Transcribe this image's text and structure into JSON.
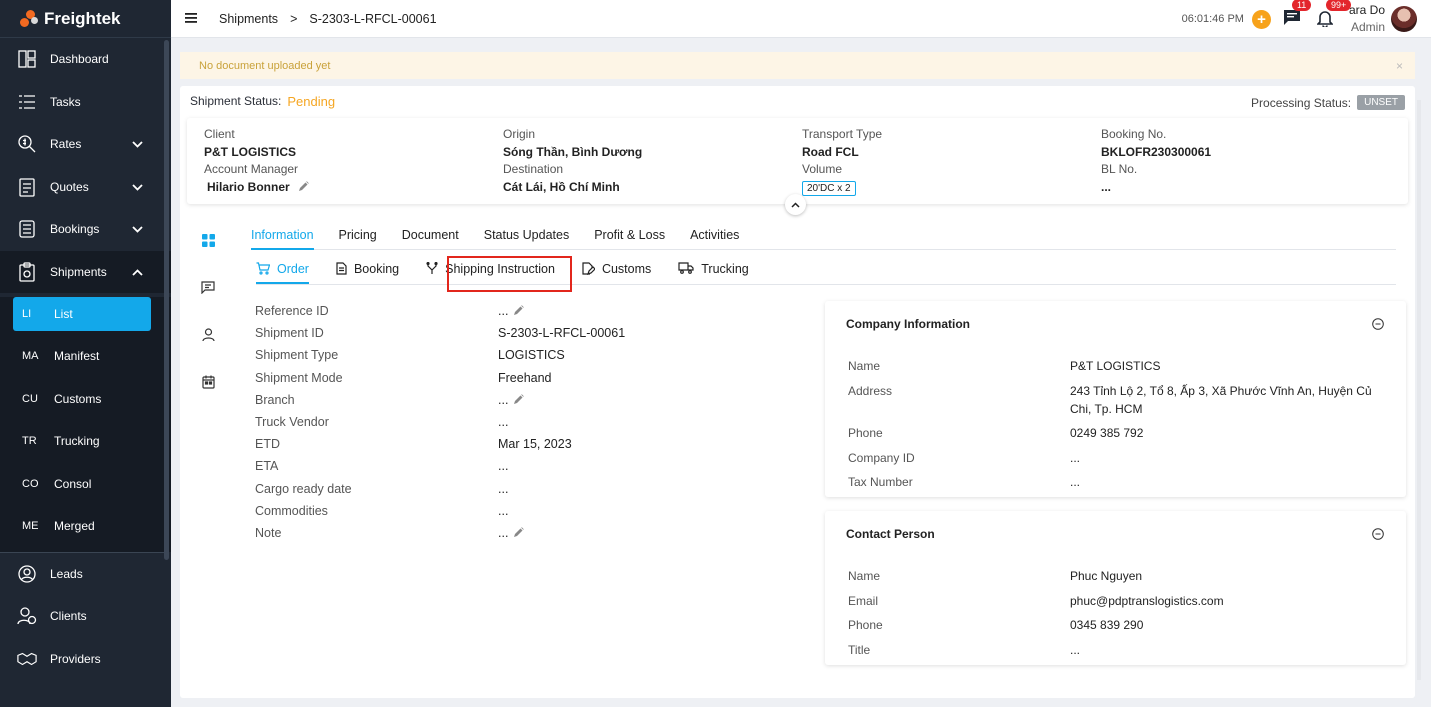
{
  "app": {
    "name": "Freightek"
  },
  "sidebar": {
    "items": [
      {
        "label": "Dashboard",
        "icon": "dashboard-icon"
      },
      {
        "label": "Tasks",
        "icon": "tasks-icon"
      },
      {
        "label": "Rates",
        "icon": "rates-icon"
      },
      {
        "label": "Quotes",
        "icon": "quotes-icon"
      },
      {
        "label": "Bookings",
        "icon": "bookings-icon"
      },
      {
        "label": "Shipments",
        "icon": "shipments-icon"
      }
    ],
    "sub_items": [
      {
        "abbr": "LI",
        "label": "List"
      },
      {
        "abbr": "MA",
        "label": "Manifest"
      },
      {
        "abbr": "CU",
        "label": "Customs"
      },
      {
        "abbr": "TR",
        "label": "Trucking"
      },
      {
        "abbr": "CO",
        "label": "Consol"
      },
      {
        "abbr": "ME",
        "label": "Merged"
      }
    ],
    "bottom_items": [
      {
        "label": "Leads",
        "icon": "leads-icon"
      },
      {
        "label": "Clients",
        "icon": "clients-icon"
      },
      {
        "label": "Providers",
        "icon": "providers-icon"
      }
    ]
  },
  "header": {
    "breadcrumb": [
      "Shipments",
      "S-2303-L-RFCL-00061"
    ],
    "breadcrumb_sep": ">",
    "time": "06:01:46 PM",
    "messages_badge": "11",
    "notifications_badge": "99+",
    "user_name": "ara Do",
    "user_role": "Admin"
  },
  "banner": {
    "text": "No document uploaded yet",
    "close": "×"
  },
  "status": {
    "label": "Shipment Status:",
    "value": "Pending",
    "processing_label": "Processing Status:",
    "processing_value": "UNSET"
  },
  "summary": {
    "client_label": "Client",
    "client": "P&T LOGISTICS",
    "manager_label": "Account Manager",
    "manager": "Hilario Bonner",
    "origin_label": "Origin",
    "origin": "Sóng Thần, Bình Dương",
    "destination_label": "Destination",
    "destination": "Cát Lái, Hồ Chí Minh",
    "transport_label": "Transport Type",
    "transport": "Road FCL",
    "volume_label": "Volume",
    "volume": "20'DC x 2",
    "booking_label": "Booking No.",
    "booking": "BKLOFR230300061",
    "bl_label": "BL No.",
    "bl": "..."
  },
  "tabs": [
    "Information",
    "Pricing",
    "Document",
    "Status Updates",
    "Profit & Loss",
    "Activities"
  ],
  "subtabs": [
    {
      "label": "Order",
      "icon": "cart-icon"
    },
    {
      "label": "Booking",
      "icon": "document-icon"
    },
    {
      "label": "Shipping Instruction",
      "icon": "fork-icon"
    },
    {
      "label": "Customs",
      "icon": "edit-doc-icon"
    },
    {
      "label": "Trucking",
      "icon": "truck-icon"
    }
  ],
  "fields": [
    {
      "label": "Reference ID",
      "value": "...",
      "editable": true
    },
    {
      "label": "Shipment ID",
      "value": "S-2303-L-RFCL-00061",
      "editable": false
    },
    {
      "label": "Shipment Type",
      "value": "LOGISTICS",
      "editable": false
    },
    {
      "label": "Shipment Mode",
      "value": "Freehand",
      "editable": false
    },
    {
      "label": "Branch",
      "value": "...",
      "editable": true
    },
    {
      "label": "Truck Vendor",
      "value": "...",
      "editable": false
    },
    {
      "label": "ETD",
      "value": "Mar 15, 2023",
      "editable": false
    },
    {
      "label": "ETA",
      "value": "...",
      "editable": false
    },
    {
      "label": "Cargo ready date",
      "value": "...",
      "editable": false
    },
    {
      "label": "Commodities",
      "value": "...",
      "editable": false
    },
    {
      "label": "Note",
      "value": "...",
      "editable": true
    }
  ],
  "company": {
    "title": "Company Information",
    "rows": [
      {
        "label": "Name",
        "value": "P&T LOGISTICS"
      },
      {
        "label": "Address",
        "value": "243 Tỉnh Lộ 2, Tổ 8, Ấp 3, Xã Phước Vĩnh An, Huyện Củ Chi, Tp. HCM"
      },
      {
        "label": "Phone",
        "value": "0249 385 792"
      },
      {
        "label": "Company ID",
        "value": "..."
      },
      {
        "label": "Tax Number",
        "value": "..."
      }
    ]
  },
  "contact": {
    "title": "Contact Person",
    "rows": [
      {
        "label": "Name",
        "value": "Phuc Nguyen"
      },
      {
        "label": "Email",
        "value": "phuc@pdptranslogistics.com"
      },
      {
        "label": "Phone",
        "value": "0345 839 290"
      },
      {
        "label": "Title",
        "value": "..."
      }
    ]
  },
  "colors": {
    "accent": "#13a8ea",
    "pending": "#f5a623",
    "sidebar": "#1f2733",
    "highlight": "#e2261c"
  }
}
